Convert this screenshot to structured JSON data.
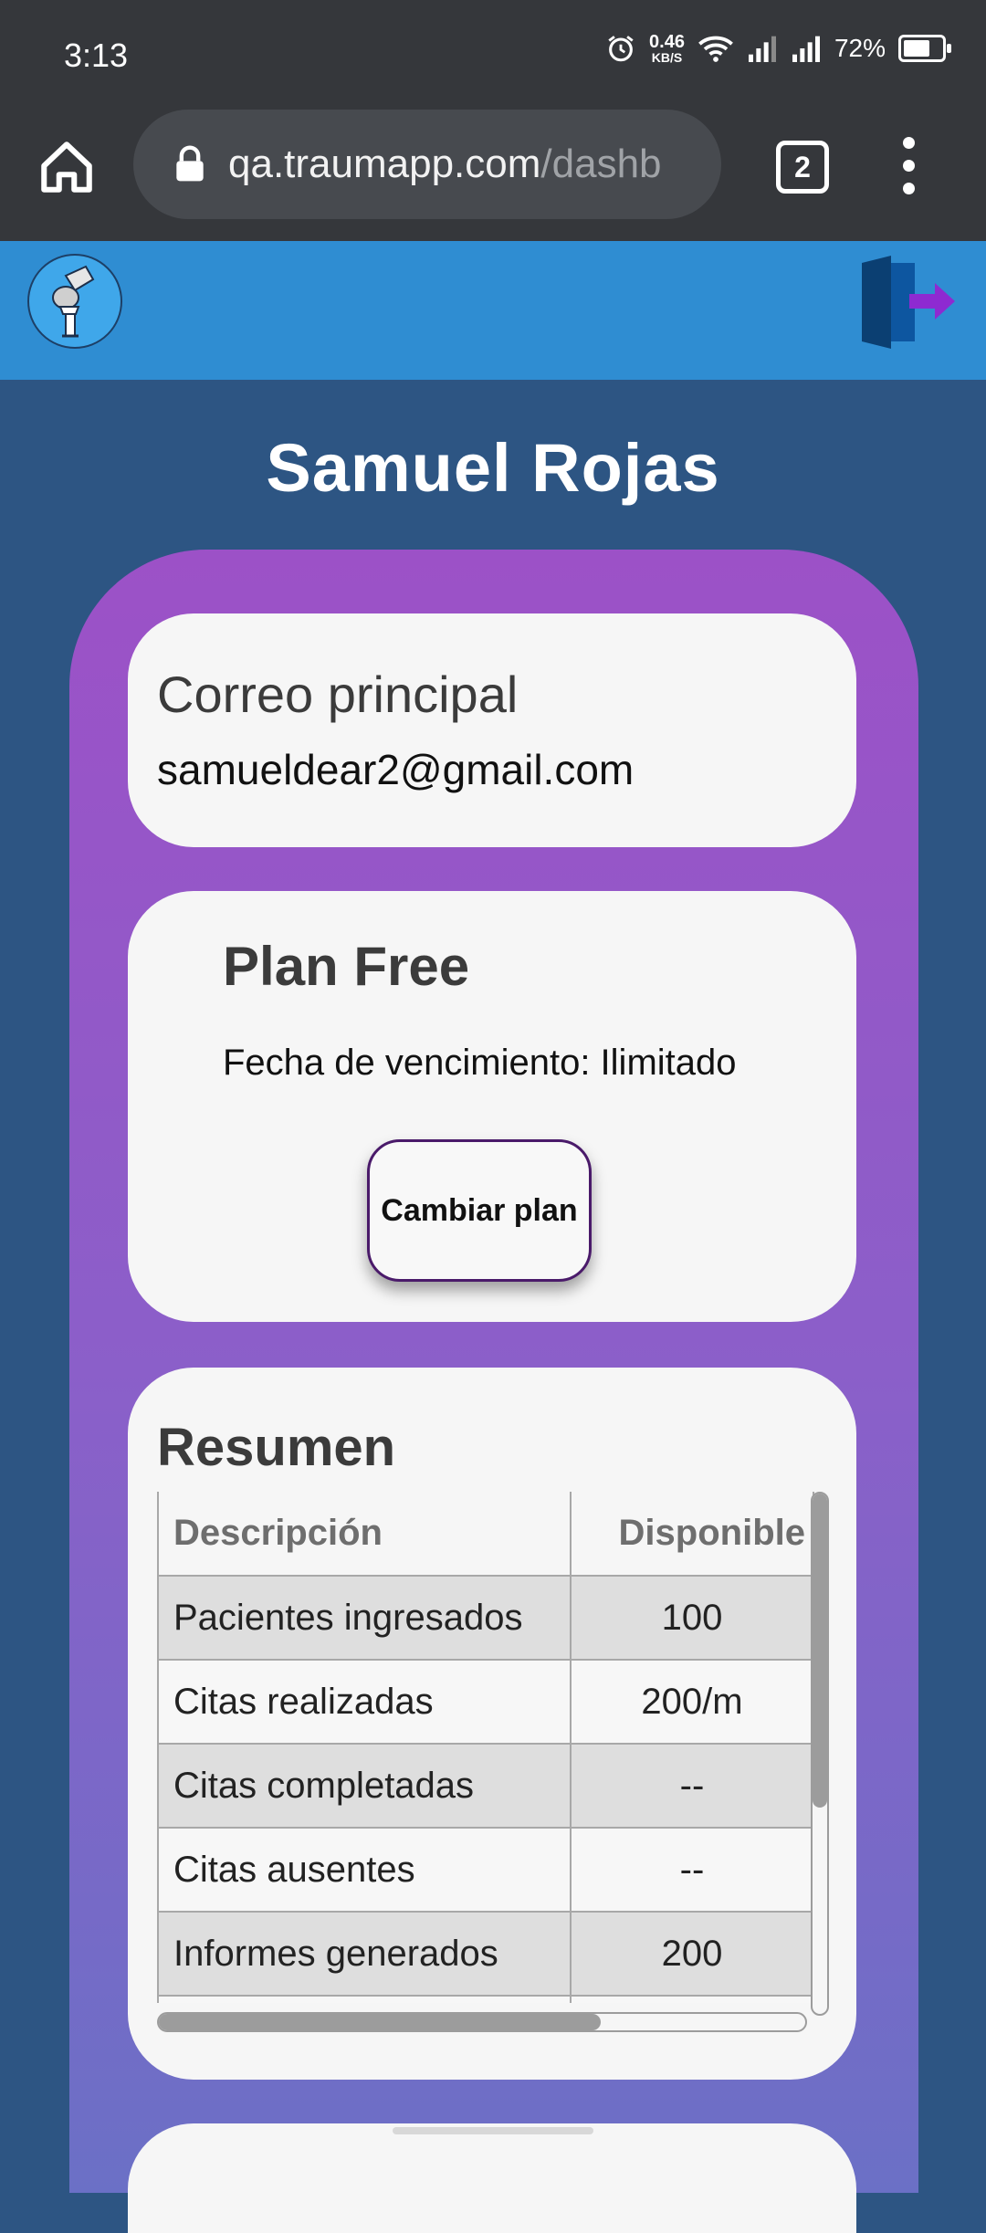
{
  "status_bar": {
    "time": "3:13",
    "net_speed": "0.46",
    "net_unit": "KB/S",
    "battery": "72%"
  },
  "browser": {
    "url_visible": "qa.traumapp.com",
    "url_faded": "/dashb",
    "tab_count": "2"
  },
  "user": {
    "name": "Samuel Rojas"
  },
  "email_card": {
    "label": "Correo principal",
    "value": "samueldear2@gmail.com"
  },
  "plan_card": {
    "title": "Plan Free",
    "expiry": "Fecha de vencimiento: Ilimitado",
    "button_label": "Cambiar plan"
  },
  "summary": {
    "title": "Resumen",
    "headers": [
      "Descripción",
      "Disponible"
    ],
    "rows": [
      [
        "Pacientes ingresados",
        "100"
      ],
      [
        "Citas realizadas",
        "200/m"
      ],
      [
        "Citas completadas",
        "--"
      ],
      [
        "Citas ausentes",
        "--"
      ],
      [
        "Informes generados",
        "200"
      ]
    ]
  },
  "colors": {
    "status_bar": "#35373b",
    "app_header": "#2f8dd2",
    "page_bg": "#2d5583",
    "panel_top": "#9c51c7",
    "panel_bottom": "#6b70c6",
    "logout_arrow": "#8e2ad1"
  },
  "icons": {
    "home": "home-icon",
    "lock": "lock-icon",
    "menu": "more-vert-icon",
    "logo": "knee-joint-logo",
    "logout": "logout-door-icon"
  }
}
